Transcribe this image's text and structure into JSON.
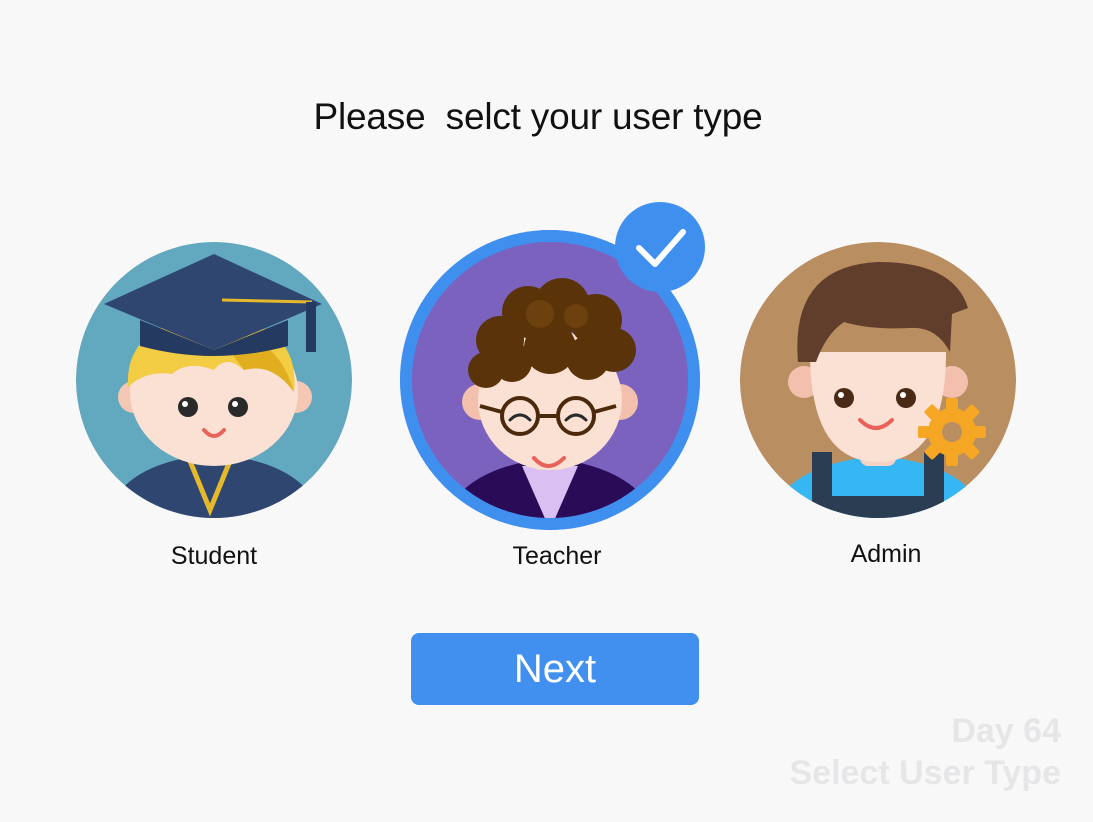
{
  "heading": "Please  selct your user type",
  "options": [
    {
      "label": "Student",
      "selected": false,
      "bg_color": "#62a8be"
    },
    {
      "label": "Teacher",
      "selected": true,
      "bg_color": "#7b62bf"
    },
    {
      "label": "Admin",
      "selected": false,
      "bg_color": "#b98e60"
    }
  ],
  "next_button": {
    "label": "Next"
  },
  "watermark": {
    "line1": "Day 64",
    "line2": "Select User Type"
  },
  "colors": {
    "accent": "#4190ef",
    "background": "#f8f8f9"
  }
}
